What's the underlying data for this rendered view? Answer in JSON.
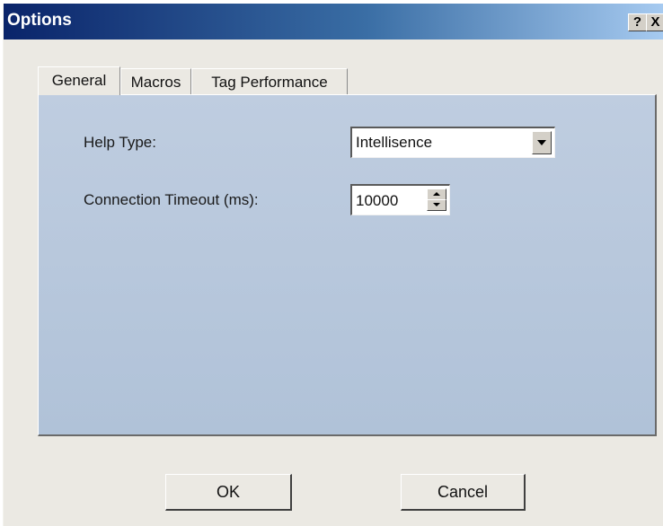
{
  "window": {
    "title": "Options",
    "help_button": "?",
    "close_button": "X"
  },
  "tabs": [
    {
      "label": "General",
      "active": true
    },
    {
      "label": "Macros",
      "active": false
    },
    {
      "label": "Tag Performance",
      "active": false
    }
  ],
  "general": {
    "help_type": {
      "label": "Help Type:",
      "value": "Intellisence"
    },
    "connection_timeout": {
      "label": "Connection Timeout (ms):",
      "value": "10000"
    }
  },
  "buttons": {
    "ok": "OK",
    "cancel": "Cancel"
  },
  "colors": {
    "titlebar_start": "#0a246a",
    "titlebar_end": "#a6caf0",
    "panel_bg": "#b8c8dc",
    "dialog_bg": "#ebe9e3"
  }
}
